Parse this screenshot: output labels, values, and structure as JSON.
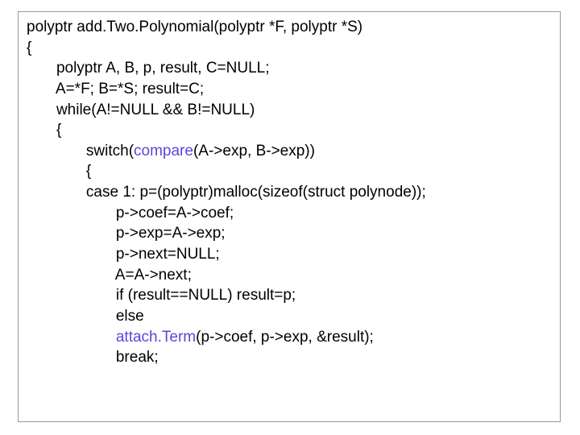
{
  "code": {
    "l1": "polyptr add.Two.Polynomial(polyptr *F, polyptr *S)",
    "l2": "{",
    "l3": "       polyptr A, B, p, result, C=NULL;",
    "l4": "       A=*F; B=*S; result=C;",
    "l5": "       while(A!=NULL && B!=NULL)",
    "l6": "       {",
    "l7a": "              switch(",
    "l7fn": "compare",
    "l7b": "(A->exp, B->exp))",
    "l8": "              {",
    "l9": "              case 1: p=(polyptr)malloc(sizeof(struct polynode));",
    "l10": "                     p->coef=A->coef;",
    "l11": "                     p->exp=A->exp;",
    "l12": "                     p->next=NULL;",
    "l13": "                     A=A->next;",
    "l14": "                     if (result==NULL) result=p;",
    "l15": "                     else",
    "l16a": "                     ",
    "l16fn": "attach.Term",
    "l16b": "(p->coef, p->exp, &result);",
    "l17": "                     break;"
  }
}
